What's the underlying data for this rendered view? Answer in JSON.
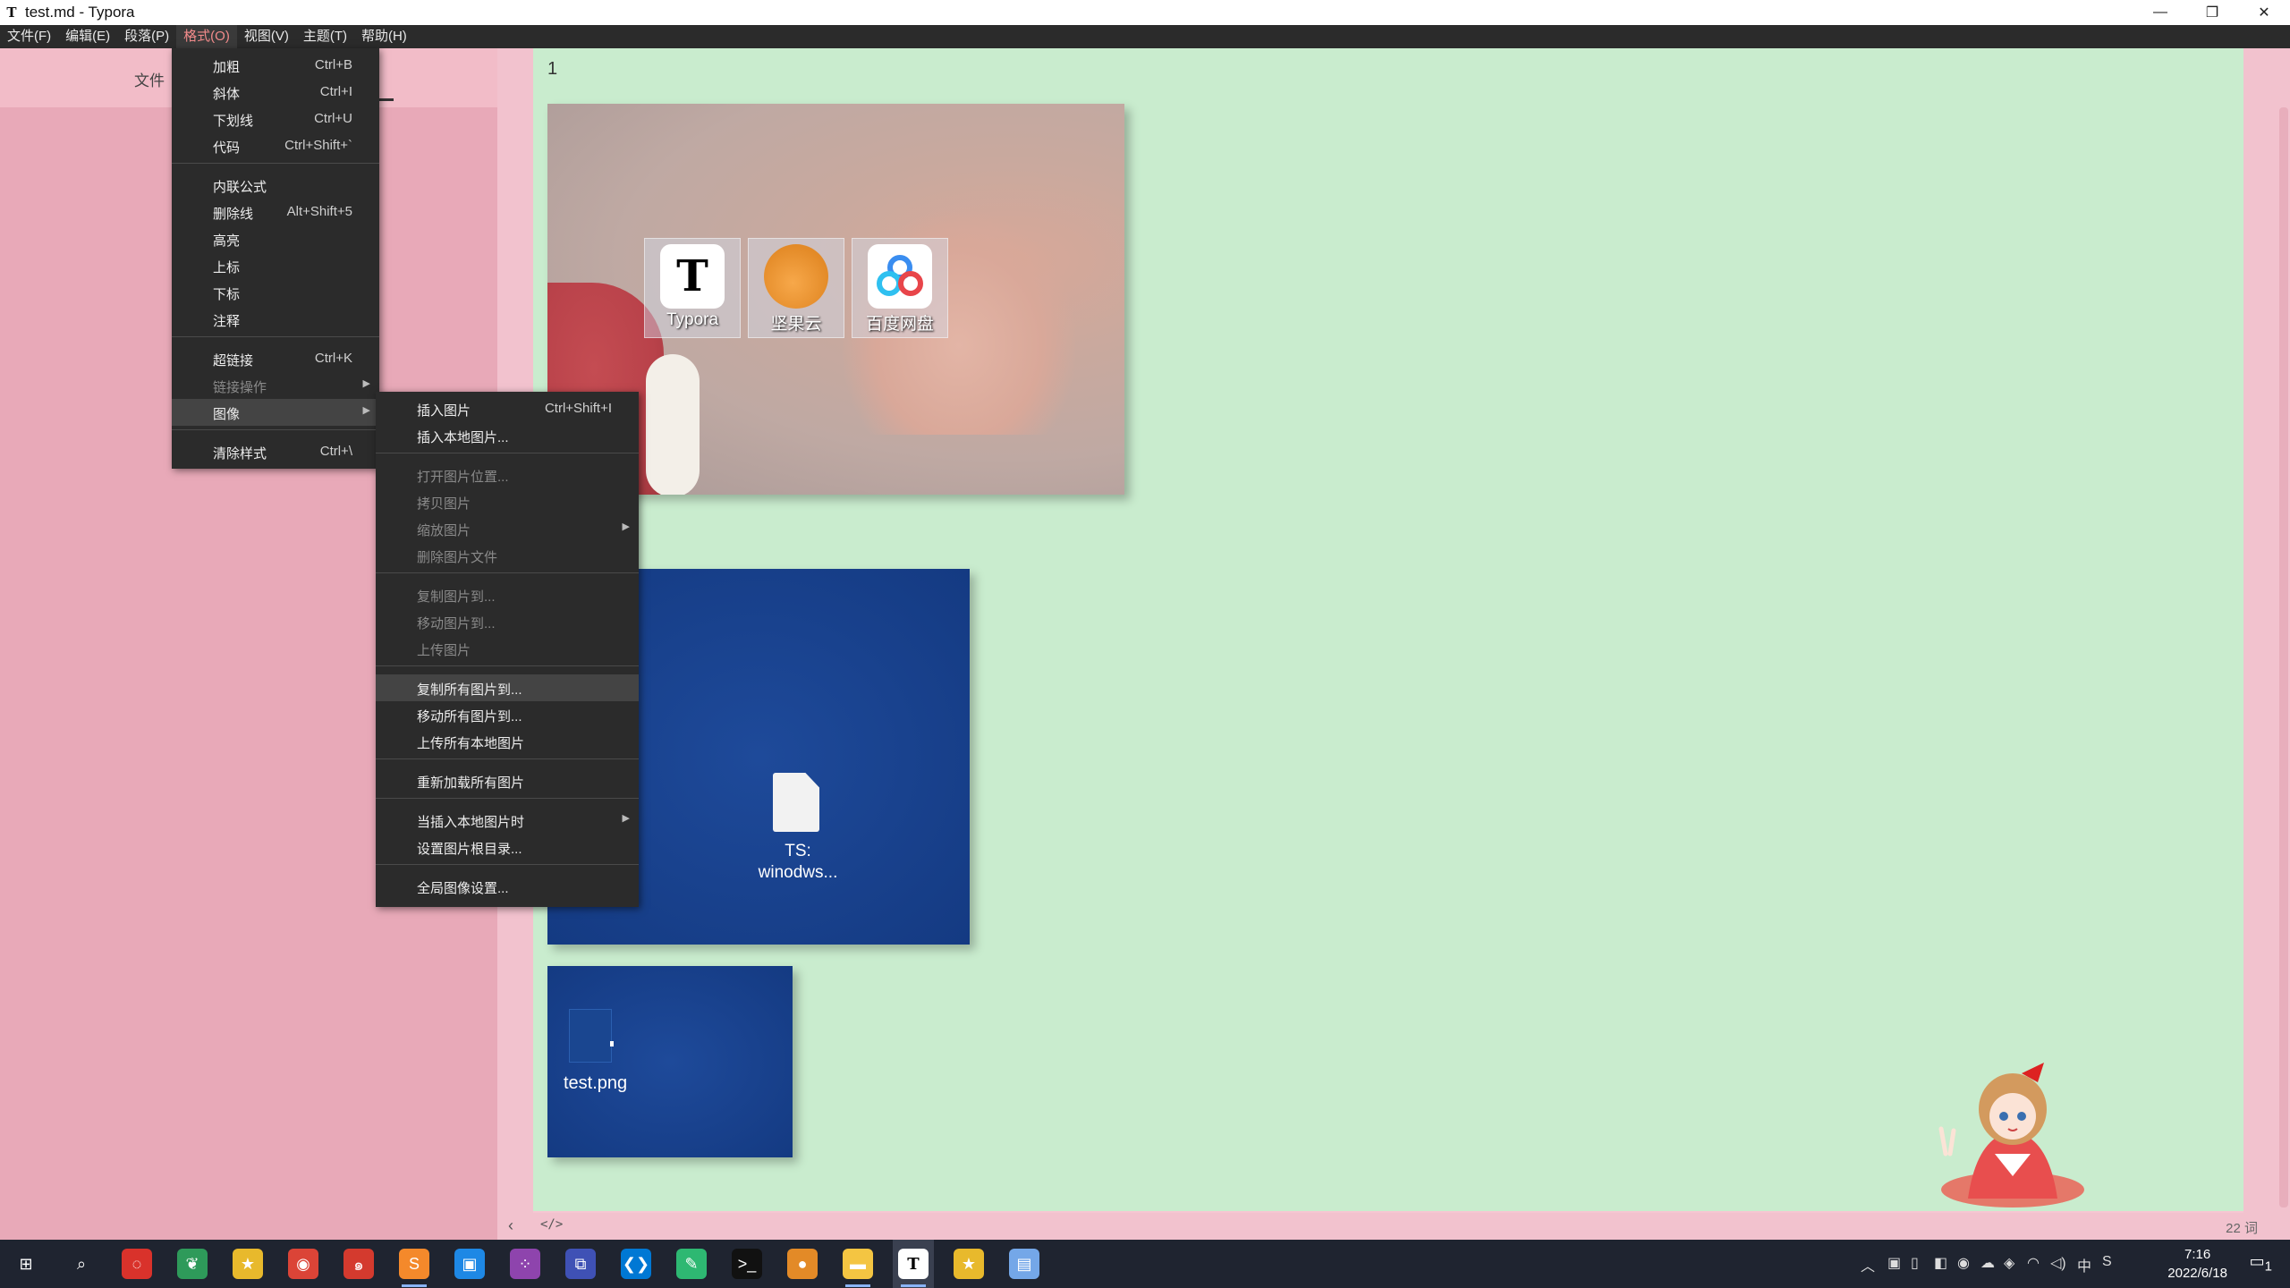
{
  "window": {
    "app_icon": "T",
    "title": "test.md - Typora",
    "controls": {
      "minimize": "—",
      "restore": "❐",
      "close": "✕"
    }
  },
  "menubar": [
    {
      "label": "文件(F)"
    },
    {
      "label": "编辑(E)"
    },
    {
      "label": "段落(P)"
    },
    {
      "label": "格式(O)",
      "active": true
    },
    {
      "label": "视图(V)"
    },
    {
      "label": "主题(T)"
    },
    {
      "label": "帮助(H)"
    }
  ],
  "sidebar": {
    "tab_label": "文件"
  },
  "editor": {
    "line_number": "1",
    "desktop_icons": [
      {
        "label": "Typora",
        "icon": "typora-icon",
        "glyph": "T"
      },
      {
        "label": "坚果云",
        "icon": "nutstore-icon",
        "glyph": ""
      },
      {
        "label": "百度网盘",
        "icon": "baidu-netdisk-icon",
        "glyph": ""
      }
    ],
    "file_icon_label_line1": "TS:",
    "file_icon_label_line2": "winodws...",
    "file3_label": "test.png"
  },
  "statusbar": {
    "back": "‹",
    "source_code": "</>",
    "word_count": "22 词"
  },
  "format_menu": {
    "items": [
      {
        "label": "加粗",
        "shortcut": "Ctrl+B"
      },
      {
        "label": "斜体",
        "shortcut": "Ctrl+I"
      },
      {
        "label": "下划线",
        "shortcut": "Ctrl+U"
      },
      {
        "label": "代码",
        "shortcut": "Ctrl+Shift+`"
      },
      {
        "label": "内联公式",
        "shortcut": ""
      },
      {
        "label": "删除线",
        "shortcut": "Alt+Shift+5"
      },
      {
        "label": "高亮",
        "shortcut": ""
      },
      {
        "label": "上标",
        "shortcut": ""
      },
      {
        "label": "下标",
        "shortcut": ""
      },
      {
        "label": "注释",
        "shortcut": ""
      },
      {
        "label": "超链接",
        "shortcut": "Ctrl+K"
      },
      {
        "label": "链接操作",
        "shortcut": "",
        "disabled": true,
        "submenu": true
      },
      {
        "label": "图像",
        "shortcut": "",
        "submenu": true,
        "highlight": true
      },
      {
        "label": "清除样式",
        "shortcut": "Ctrl+\\"
      }
    ]
  },
  "image_submenu": {
    "items": [
      {
        "label": "插入图片",
        "shortcut": "Ctrl+Shift+I"
      },
      {
        "label": "插入本地图片..."
      },
      {
        "label": "打开图片位置...",
        "disabled": true
      },
      {
        "label": "拷贝图片",
        "disabled": true
      },
      {
        "label": "缩放图片",
        "disabled": true,
        "submenu": true
      },
      {
        "label": "删除图片文件",
        "disabled": true
      },
      {
        "label": "复制图片到...",
        "disabled": true
      },
      {
        "label": "移动图片到...",
        "disabled": true
      },
      {
        "label": "上传图片",
        "disabled": true
      },
      {
        "label": "复制所有图片到...",
        "highlight": true
      },
      {
        "label": "移动所有图片到..."
      },
      {
        "label": "上传所有本地图片"
      },
      {
        "label": "重新加载所有图片"
      },
      {
        "label": "当插入本地图片时",
        "submenu": true
      },
      {
        "label": "设置图片根目录..."
      },
      {
        "label": "全局图像设置..."
      }
    ]
  },
  "taskbar": {
    "apps": [
      {
        "name": "start-button",
        "glyph": "⊞",
        "color": "#1f2430"
      },
      {
        "name": "search-icon",
        "glyph": "⌕",
        "color": "#1f2430"
      },
      {
        "name": "app-red-swirl",
        "glyph": "◌",
        "color": "#d9322b"
      },
      {
        "name": "app-green-leaf",
        "glyph": "❦",
        "color": "#2e9a5a"
      },
      {
        "name": "app-star",
        "glyph": "★",
        "color": "#e8b92c"
      },
      {
        "name": "chrome-icon",
        "glyph": "◉",
        "color": "#db4437"
      },
      {
        "name": "app-red-snail",
        "glyph": "๑",
        "color": "#d43a2e"
      },
      {
        "name": "sublime-icon",
        "glyph": "S",
        "color": "#f4892b"
      },
      {
        "name": "app-blue-frame",
        "glyph": "▣",
        "color": "#1e88e5"
      },
      {
        "name": "app-dots",
        "glyph": "⁘",
        "color": "#8e44ad"
      },
      {
        "name": "app-network",
        "glyph": "⧉",
        "color": "#3f51b5"
      },
      {
        "name": "vscode-icon",
        "glyph": "❮❯",
        "color": "#0078d4"
      },
      {
        "name": "app-green-book",
        "glyph": "✎",
        "color": "#2eb872"
      },
      {
        "name": "terminal-icon",
        "glyph": ">_",
        "color": "#111111"
      },
      {
        "name": "app-orange-acorn",
        "glyph": "●",
        "color": "#e38a27"
      },
      {
        "name": "file-explorer-icon",
        "glyph": "▬",
        "color": "#f4c542"
      },
      {
        "name": "typora-taskbar-icon",
        "glyph": "T",
        "color": "#ffffff",
        "active": true
      },
      {
        "name": "app-star-2",
        "glyph": "★",
        "color": "#e8b92c"
      },
      {
        "name": "app-notepad",
        "glyph": "▤",
        "color": "#74a7e8"
      }
    ],
    "tray": {
      "chevron": "︿",
      "ime": "中",
      "time": "7:16",
      "date": "2022/6/18",
      "notify_count": "1"
    }
  },
  "colors": {
    "menubar_bg": "#2b2b2b",
    "menu_active_text": "#f28b8b",
    "sidebar_bg": "#e8a9b8",
    "editor_bg": "#c9ecce",
    "taskbar_bg": "#1f2430"
  }
}
